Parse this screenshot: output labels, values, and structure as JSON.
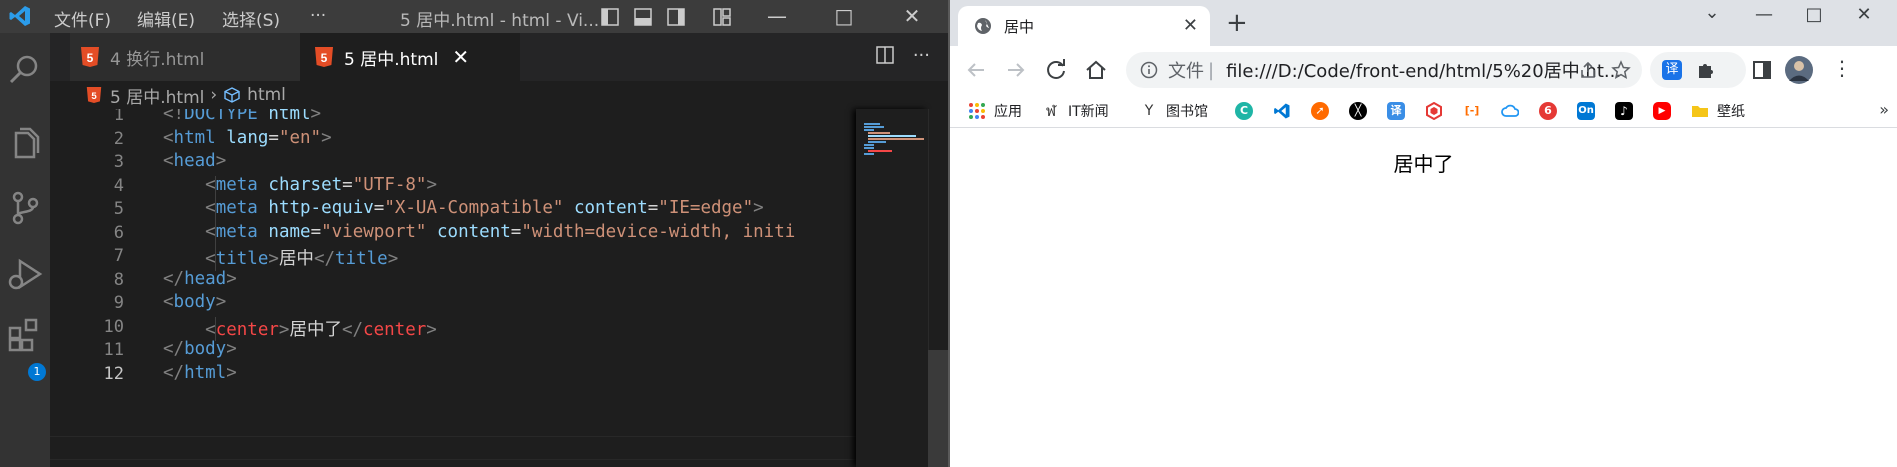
{
  "vscode": {
    "menu": [
      "文件(F)",
      "编辑(E)",
      "选择(S)",
      "···"
    ],
    "window_title": "5 居中.html - html - Vi...",
    "tabs": [
      {
        "label": "4 换行.html",
        "active": false
      },
      {
        "label": "5 居中.html",
        "active": true,
        "close": "✕"
      }
    ],
    "breadcrumb": {
      "file": "5 居中.html",
      "symbol": "html"
    },
    "extensions_badge": "1",
    "line_numbers": [
      "1",
      "2",
      "3",
      "4",
      "5",
      "6",
      "7",
      "8",
      "9",
      "10",
      "11",
      "12"
    ]
  },
  "chrome": {
    "tab_title": "居中",
    "tab_close": "✕",
    "new_tab": "+",
    "omnibox": {
      "scheme": "文件",
      "separator": "|",
      "url": "file:///D:/Code/front-end/html/5%20居中.ht..."
    },
    "bookmarks": [
      {
        "label": "应用",
        "icon": "apps-grid-icon"
      },
      {
        "label": "IT新闻",
        "icon": "it-news-icon"
      },
      {
        "label": "图书馆",
        "icon": "library-icon"
      },
      {
        "label": "",
        "icon": "c-icon",
        "color": "#1fb5a6",
        "text": "C"
      },
      {
        "label": "",
        "icon": "vscode-icon",
        "color": "#0078d4",
        "text": ""
      },
      {
        "label": "",
        "icon": "compass-icon",
        "color": "#ff6a00",
        "text": ""
      },
      {
        "label": "",
        "icon": "tool-icon",
        "color": "#000000",
        "text": ""
      },
      {
        "label": "",
        "icon": "translate-icon",
        "color": "#3a8ee6",
        "text": "译"
      },
      {
        "label": "",
        "icon": "cube-icon",
        "color": "#e53935",
        "text": ""
      },
      {
        "label": "",
        "icon": "bracket-icon",
        "color": "#ff6d00",
        "text": "[-]"
      },
      {
        "label": "",
        "icon": "cloud-icon",
        "color": "#2196f3",
        "text": ""
      },
      {
        "label": "",
        "icon": "weibo-icon",
        "color": "#e53935",
        "text": "6"
      },
      {
        "label": "",
        "icon": "on-icon",
        "color": "#0078d4",
        "text": "On"
      },
      {
        "label": "",
        "icon": "tiktok-icon",
        "color": "#000000",
        "text": "♪"
      },
      {
        "label": "",
        "icon": "youtube-icon",
        "color": "#ff0000",
        "text": "▶"
      },
      {
        "label": "壁纸",
        "icon": "folder-icon",
        "color": "#f5c518",
        "text": ""
      }
    ],
    "page_text": "居中了"
  }
}
